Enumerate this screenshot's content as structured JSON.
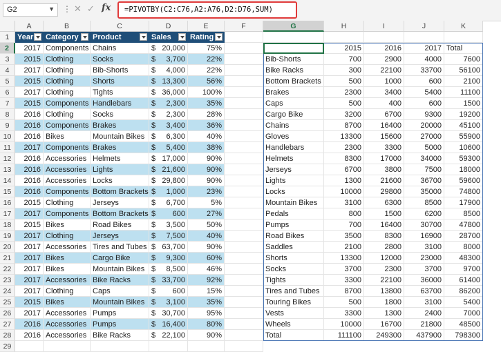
{
  "formula_bar": {
    "name_box": "G2",
    "dots": "⋮",
    "cancel_icon": "✕",
    "enter_icon": "✓",
    "fx_label": "fx",
    "formula": "=PIVOTBY(C2:C76,A2:A76,D2:D76,SUM)"
  },
  "columns": [
    "A",
    "B",
    "C",
    "D",
    "E",
    "F",
    "G",
    "H",
    "I",
    "J",
    "K"
  ],
  "rows": [
    "1",
    "2",
    "3",
    "4",
    "5",
    "6",
    "7",
    "8",
    "9",
    "10",
    "11",
    "12",
    "13",
    "14",
    "15",
    "16",
    "17",
    "18",
    "19",
    "20",
    "21",
    "22",
    "23",
    "24",
    "25",
    "26",
    "27",
    "28",
    "29"
  ],
  "table": {
    "headers": [
      "Year",
      "Category",
      "Product",
      "Sales",
      "Rating"
    ],
    "rows": [
      [
        "2017",
        "Components",
        "Chains",
        "20,000",
        "75%"
      ],
      [
        "2015",
        "Clothing",
        "Socks",
        "3,700",
        "22%"
      ],
      [
        "2017",
        "Clothing",
        "Bib-Shorts",
        "4,000",
        "22%"
      ],
      [
        "2015",
        "Clothing",
        "Shorts",
        "13,300",
        "56%"
      ],
      [
        "2017",
        "Clothing",
        "Tights",
        "36,000",
        "100%"
      ],
      [
        "2015",
        "Components",
        "Handlebars",
        "2,300",
        "35%"
      ],
      [
        "2016",
        "Clothing",
        "Socks",
        "2,300",
        "28%"
      ],
      [
        "2016",
        "Components",
        "Brakes",
        "3,400",
        "36%"
      ],
      [
        "2016",
        "Bikes",
        "Mountain Bikes",
        "6,300",
        "40%"
      ],
      [
        "2017",
        "Components",
        "Brakes",
        "5,400",
        "38%"
      ],
      [
        "2016",
        "Accessories",
        "Helmets",
        "17,000",
        "90%"
      ],
      [
        "2016",
        "Accessories",
        "Lights",
        "21,600",
        "90%"
      ],
      [
        "2016",
        "Accessories",
        "Locks",
        "29,800",
        "90%"
      ],
      [
        "2016",
        "Components",
        "Bottom Brackets",
        "1,000",
        "23%"
      ],
      [
        "2015",
        "Clothing",
        "Jerseys",
        "6,700",
        "5%"
      ],
      [
        "2017",
        "Components",
        "Bottom Brackets",
        "600",
        "27%"
      ],
      [
        "2015",
        "Bikes",
        "Road Bikes",
        "3,500",
        "50%"
      ],
      [
        "2017",
        "Clothing",
        "Jerseys",
        "7,500",
        "40%"
      ],
      [
        "2017",
        "Accessories",
        "Tires and Tubes",
        "63,700",
        "90%"
      ],
      [
        "2017",
        "Bikes",
        "Cargo Bike",
        "9,300",
        "60%"
      ],
      [
        "2017",
        "Bikes",
        "Mountain Bikes",
        "8,500",
        "46%"
      ],
      [
        "2017",
        "Accessories",
        "Bike Racks",
        "33,700",
        "92%"
      ],
      [
        "2017",
        "Clothing",
        "Caps",
        "600",
        "15%"
      ],
      [
        "2015",
        "Bikes",
        "Mountain Bikes",
        "3,100",
        "35%"
      ],
      [
        "2017",
        "Accessories",
        "Pumps",
        "30,700",
        "95%"
      ],
      [
        "2016",
        "Accessories",
        "Pumps",
        "16,400",
        "80%"
      ],
      [
        "2016",
        "Accessories",
        "Bike Racks",
        "22,100",
        "90%"
      ]
    ]
  },
  "pivot": {
    "headers": [
      "2015",
      "2016",
      "2017",
      "Total"
    ],
    "rows": [
      [
        "Bib-Shorts",
        "700",
        "2900",
        "4000",
        "7600"
      ],
      [
        "Bike Racks",
        "300",
        "22100",
        "33700",
        "56100"
      ],
      [
        "Bottom Brackets",
        "500",
        "1000",
        "600",
        "2100"
      ],
      [
        "Brakes",
        "2300",
        "3400",
        "5400",
        "11100"
      ],
      [
        "Caps",
        "500",
        "400",
        "600",
        "1500"
      ],
      [
        "Cargo Bike",
        "3200",
        "6700",
        "9300",
        "19200"
      ],
      [
        "Chains",
        "8700",
        "16400",
        "20000",
        "45100"
      ],
      [
        "Gloves",
        "13300",
        "15600",
        "27000",
        "55900"
      ],
      [
        "Handlebars",
        "2300",
        "3300",
        "5000",
        "10600"
      ],
      [
        "Helmets",
        "8300",
        "17000",
        "34000",
        "59300"
      ],
      [
        "Jerseys",
        "6700",
        "3800",
        "7500",
        "18000"
      ],
      [
        "Lights",
        "1300",
        "21600",
        "36700",
        "59600"
      ],
      [
        "Locks",
        "10000",
        "29800",
        "35000",
        "74800"
      ],
      [
        "Mountain Bikes",
        "3100",
        "6300",
        "8500",
        "17900"
      ],
      [
        "Pedals",
        "800",
        "1500",
        "6200",
        "8500"
      ],
      [
        "Pumps",
        "700",
        "16400",
        "30700",
        "47800"
      ],
      [
        "Road Bikes",
        "3500",
        "8300",
        "16900",
        "28700"
      ],
      [
        "Saddles",
        "2100",
        "2800",
        "3100",
        "8000"
      ],
      [
        "Shorts",
        "13300",
        "12000",
        "23000",
        "48300"
      ],
      [
        "Socks",
        "3700",
        "2300",
        "3700",
        "9700"
      ],
      [
        "Tights",
        "3300",
        "22100",
        "36000",
        "61400"
      ],
      [
        "Tires and Tubes",
        "8700",
        "13800",
        "63700",
        "86200"
      ],
      [
        "Touring Bikes",
        "500",
        "1800",
        "3100",
        "5400"
      ],
      [
        "Vests",
        "3300",
        "1300",
        "2400",
        "7000"
      ],
      [
        "Wheels",
        "10000",
        "16700",
        "21800",
        "48500"
      ],
      [
        "Total",
        "111100",
        "249300",
        "437900",
        "798300"
      ]
    ]
  },
  "colors": {
    "header_fill": "#1f4e78",
    "band_fill": "#bde0f0",
    "formula_highlight": "#e03a3a",
    "selection": "#217346"
  }
}
